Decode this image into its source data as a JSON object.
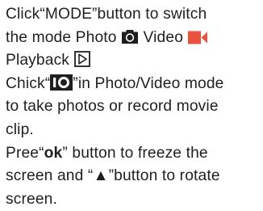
{
  "instructions": {
    "line1": {
      "text": "Click“MODE”button to switch"
    },
    "line2": {
      "before": "the mode Photo ",
      "video_label": " Video ",
      "photo_icon": "camera-icon",
      "video_icon": "video-camera-icon",
      "video_icon_color": "#e8523f"
    },
    "line3": {
      "label": "Playback ",
      "playback_icon": "playback-icon"
    },
    "line4": {
      "before": "Chick“",
      "after": "”in Photo/Video mode",
      "shutter_icon": "shutter-button-icon",
      "shutter_text": "IO"
    },
    "line5": {
      "text": "to take photos or record movie"
    },
    "line6": {
      "text": "clip."
    },
    "line7": {
      "before": "Pree“",
      "key": "ok",
      "after": "” button to freeze the"
    },
    "line8": {
      "before": "screen and “",
      "arrow": "▲",
      "after": "”button to rotate"
    },
    "line9": {
      "text": "screen."
    }
  }
}
